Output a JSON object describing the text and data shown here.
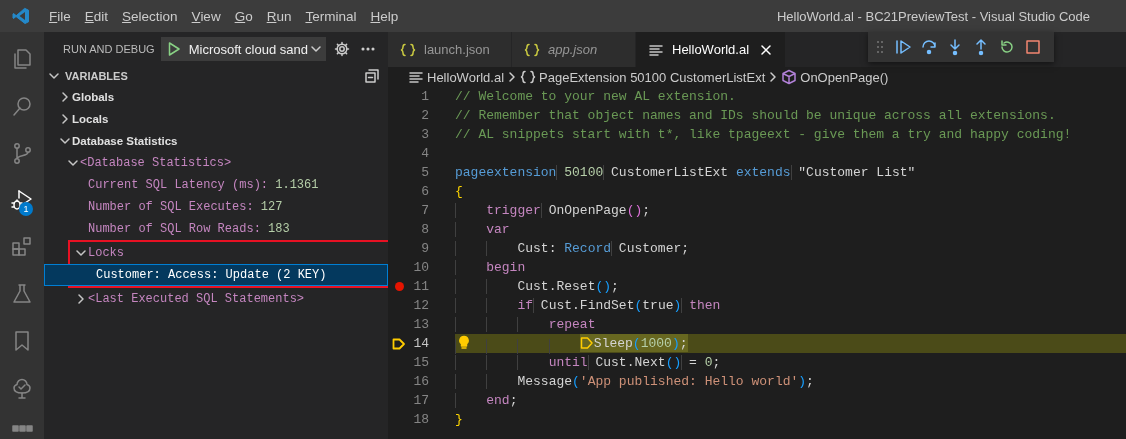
{
  "title_bar": {
    "menu": [
      "File",
      "Edit",
      "Selection",
      "View",
      "Go",
      "Run",
      "Terminal",
      "Help"
    ],
    "title": "HelloWorld.al - BC21PreviewTest - Visual Studio Code"
  },
  "activity_bar": [
    {
      "kind": "explorer",
      "selected": false
    },
    {
      "kind": "search",
      "selected": false
    },
    {
      "kind": "source-control",
      "selected": false
    },
    {
      "kind": "run-debug",
      "selected": true,
      "badge": "1"
    },
    {
      "kind": "extensions",
      "selected": false
    },
    {
      "kind": "testing",
      "selected": false
    },
    {
      "kind": "bookmarks",
      "selected": false
    },
    {
      "kind": "tree",
      "selected": false
    },
    {
      "kind": "grid",
      "selected": false
    }
  ],
  "sidebar": {
    "title": "RUN AND DEBUG",
    "configuration": "Microsoft cloud sand",
    "section": {
      "title": "VARIABLES",
      "expanded": true,
      "tree": [
        {
          "label": "Globals",
          "kind": "scope",
          "expanded": false,
          "selected": false
        },
        {
          "label": "Locals",
          "kind": "scope",
          "expanded": false,
          "selected": false
        },
        {
          "label": "Database Statistics",
          "kind": "scope",
          "expanded": true,
          "selected": false,
          "children": [
            {
              "label": "<Database Statistics>",
              "kind": "variable",
              "expanded": true,
              "selected": false,
              "children": [
                {
                  "label": "Current SQL Latency (ms):",
                  "value": "1.1361",
                  "kind": "variable",
                  "selected": false
                },
                {
                  "label": "Number of SQL Executes:",
                  "value": "127",
                  "kind": "variable",
                  "selected": false
                },
                {
                  "label": "Number of SQL Row Reads:",
                  "value": "183",
                  "kind": "variable",
                  "selected": false
                },
                {
                  "label": "Locks",
                  "kind": "variable",
                  "expanded": true,
                  "selected": false,
                  "framed": true,
                  "children": [
                    {
                      "label": "Customer: Access: Update (2 KEY)",
                      "kind": "variable",
                      "selected": true
                    }
                  ]
                },
                {
                  "label": "<Last Executed SQL Statements>",
                  "kind": "variable",
                  "expanded": false,
                  "selected": false
                }
              ]
            }
          ]
        }
      ]
    }
  },
  "tabs": [
    {
      "label": "launch.json",
      "kind": "json",
      "selected": false,
      "preview": false
    },
    {
      "label": "app.json",
      "kind": "json",
      "selected": false,
      "preview": true
    },
    {
      "label": "HelloWorld.al",
      "kind": "source",
      "selected": true,
      "preview": false
    }
  ],
  "debug_toolbar": [
    {
      "kind": "continue"
    },
    {
      "kind": "step-over"
    },
    {
      "kind": "step-into"
    },
    {
      "kind": "step-out"
    },
    {
      "kind": "restart"
    },
    {
      "kind": "stop"
    }
  ],
  "breadcrumb": [
    {
      "kind": "file",
      "text": "HelloWorld.al"
    },
    {
      "kind": "braces",
      "text": "PageExtension 50100 CustomerListExt"
    },
    {
      "kind": "method",
      "text": "OnOpenPage()"
    }
  ],
  "editor": {
    "lines": [
      {
        "number": "1",
        "tokens": [
          {
            "kind": "comment",
            "text": "// Welcome to your new AL extension."
          }
        ]
      },
      {
        "number": "2",
        "tokens": [
          {
            "kind": "comment",
            "text": "// Remember that object names and IDs should be unique across all extensions."
          }
        ]
      },
      {
        "number": "3",
        "tokens": [
          {
            "kind": "comment",
            "text": "// AL snippets start with t*, like tpageext - give them a try and happy coding!"
          }
        ]
      },
      {
        "number": "4"
      },
      {
        "number": "5",
        "tokens": [
          {
            "kind": "keyword",
            "text": "pageextension"
          },
          {
            "kind": "number",
            "text": " 50100"
          },
          {
            "kind": "plain",
            "text": " CustomerListExt "
          },
          {
            "kind": "keyword",
            "text": "extends"
          },
          {
            "kind": "plain",
            "text": " \"Customer List\""
          }
        ]
      },
      {
        "number": "6",
        "tokens": [
          {
            "kind": "bracket1",
            "text": "{"
          }
        ]
      },
      {
        "number": "7",
        "tokens": [
          {
            "kind": "control",
            "text": "    trigger"
          },
          {
            "kind": "plain",
            "text": " OnOpenPage"
          },
          {
            "kind": "bracket2",
            "text": "()"
          },
          {
            "kind": "plain",
            "text": ";"
          }
        ]
      },
      {
        "number": "8",
        "tokens": [
          {
            "kind": "control",
            "text": "    var"
          }
        ]
      },
      {
        "number": "9",
        "tokens": [
          {
            "kind": "plain",
            "text": "        Cust: "
          },
          {
            "kind": "keyword",
            "text": "Record"
          },
          {
            "kind": "plain",
            "text": " Customer;"
          }
        ]
      },
      {
        "number": "10",
        "tokens": [
          {
            "kind": "control",
            "text": "    begin"
          }
        ]
      },
      {
        "number": "11",
        "breakpoint": true,
        "tokens": [
          {
            "kind": "plain",
            "text": "        Cust.Reset"
          },
          {
            "kind": "bracket3",
            "text": "()"
          },
          {
            "kind": "plain",
            "text": ";"
          }
        ]
      },
      {
        "number": "12",
        "tokens": [
          {
            "kind": "control",
            "text": "        if"
          },
          {
            "kind": "plain",
            "text": " Cust.FindSet"
          },
          {
            "kind": "bracket3",
            "text": "("
          },
          {
            "kind": "plain",
            "text": "true"
          },
          {
            "kind": "bracket3",
            "text": ")"
          },
          {
            "kind": "control",
            "text": " then"
          }
        ]
      },
      {
        "number": "13",
        "tokens": [
          {
            "kind": "control",
            "text": "            repeat"
          }
        ]
      },
      {
        "number": "14",
        "current": true,
        "lightbulb": true,
        "statement": [
          {
            "kind": "plain",
            "text": "                Sleep"
          },
          {
            "kind": "bracket3",
            "text": "("
          },
          {
            "kind": "number",
            "text": "1000"
          },
          {
            "kind": "bracket3",
            "text": ")"
          },
          {
            "kind": "plain",
            "text": ";"
          }
        ]
      },
      {
        "number": "15",
        "tokens": [
          {
            "kind": "control",
            "text": "            until"
          },
          {
            "kind": "plain",
            "text": " Cust.Next"
          },
          {
            "kind": "bracket3",
            "text": "()"
          },
          {
            "kind": "plain",
            "text": " = "
          },
          {
            "kind": "number",
            "text": "0"
          },
          {
            "kind": "plain",
            "text": ";"
          }
        ]
      },
      {
        "number": "16",
        "tokens": [
          {
            "kind": "plain",
            "text": "        Message"
          },
          {
            "kind": "bracket3",
            "text": "("
          },
          {
            "kind": "string",
            "text": "'App published: Hello world'"
          },
          {
            "kind": "bracket3",
            "text": ")"
          },
          {
            "kind": "plain",
            "text": ";"
          }
        ]
      },
      {
        "number": "17",
        "tokens": [
          {
            "kind": "control",
            "text": "    end"
          },
          {
            "kind": "plain",
            "text": ";"
          }
        ]
      },
      {
        "number": "18",
        "tokens": [
          {
            "kind": "bracket1",
            "text": "}"
          }
        ]
      }
    ]
  }
}
